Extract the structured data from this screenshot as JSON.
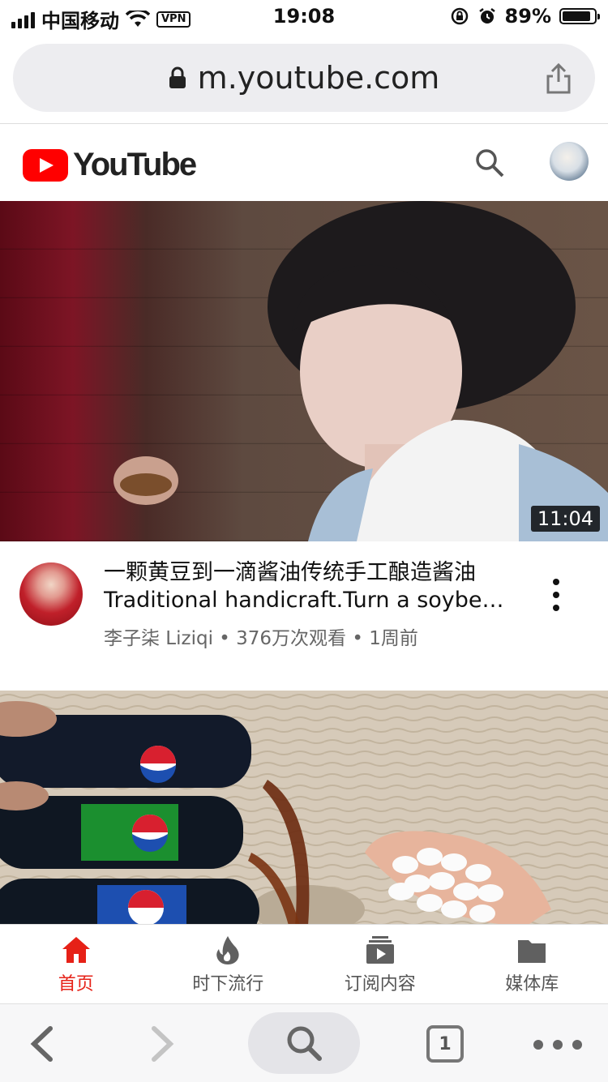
{
  "status_bar": {
    "carrier": "中国移动",
    "vpn": "VPN",
    "time": "19:08",
    "battery": "89%",
    "battery_level": 0.89
  },
  "address_bar": {
    "url": "m.youtube.com"
  },
  "youtube_header": {
    "logo_text": "YouTube"
  },
  "videos": [
    {
      "duration": "11:04",
      "title_line1": "一颗黄豆到一滴酱油传统手工酿造酱油",
      "title_line2": "Traditional handicraft.Turn a soybean…",
      "channel": "李子柒 Liziqi",
      "views": "376万次观看",
      "age": "1周前",
      "meta": "李子柒 Liziqi • 376万次观看 • 1周前"
    }
  ],
  "bottom_nav": {
    "items": [
      {
        "label": "首页",
        "icon": "home-icon",
        "active": true
      },
      {
        "label": "时下流行",
        "icon": "trending-icon",
        "active": false
      },
      {
        "label": "订阅内容",
        "icon": "subscriptions-icon",
        "active": false
      },
      {
        "label": "媒体库",
        "icon": "library-icon",
        "active": false
      }
    ]
  },
  "browser_toolbar": {
    "tab_count": "1"
  },
  "colors": {
    "accent": "#e62117",
    "youtube_red": "#ff0000"
  }
}
